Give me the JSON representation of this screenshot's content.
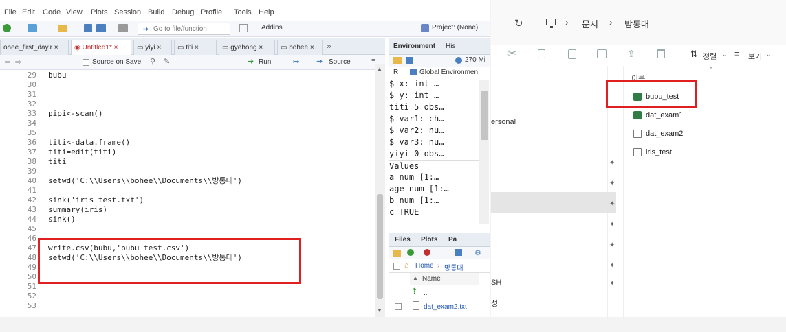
{
  "rstudio": {
    "menu": [
      "File",
      "Edit",
      "Code",
      "View",
      "Plots",
      "Session",
      "Build",
      "Debug",
      "Profile",
      "Tools",
      "Help"
    ],
    "goto_placeholder": "Go to file/function",
    "addins": "Addins",
    "project": "Project: (None)",
    "tabs": [
      "ohee_first_day.r",
      "Untitled1*",
      "yiyi",
      "titi",
      "gyehong",
      "bohee"
    ],
    "source_on_save": "Source on Save",
    "run": "Run",
    "source": "Source",
    "lines": [
      {
        "n": "29",
        "t": "bubu"
      },
      {
        "n": "30",
        "t": ""
      },
      {
        "n": "31",
        "t": ""
      },
      {
        "n": "32",
        "t": ""
      },
      {
        "n": "33",
        "t": "pipi<-scan()"
      },
      {
        "n": "34",
        "t": ""
      },
      {
        "n": "35",
        "t": ""
      },
      {
        "n": "36",
        "t": "titi<-data.frame()"
      },
      {
        "n": "37",
        "t": "titi=edit(titi)"
      },
      {
        "n": "38",
        "t": "titi"
      },
      {
        "n": "39",
        "t": ""
      },
      {
        "n": "40",
        "t": "setwd('C:\\\\Users\\\\bohee\\\\Documents\\\\방통대')"
      },
      {
        "n": "41",
        "t": ""
      },
      {
        "n": "42",
        "t": "sink('iris_test.txt')"
      },
      {
        "n": "43",
        "t": "summary(iris)"
      },
      {
        "n": "44",
        "t": "sink()"
      },
      {
        "n": "45",
        "t": ""
      },
      {
        "n": "46",
        "t": ""
      },
      {
        "n": "47",
        "t": "write.csv(bubu,'bubu_test.csv')"
      },
      {
        "n": "48",
        "t": "setwd('C:\\\\Users\\\\bohee\\\\Documents\\\\방통대')"
      },
      {
        "n": "49",
        "t": ""
      },
      {
        "n": "50",
        "t": ""
      },
      {
        "n": "51",
        "t": ""
      },
      {
        "n": "52",
        "t": ""
      },
      {
        "n": "53",
        "t": ""
      }
    ],
    "env": {
      "tab_environment": "Environment",
      "tab_history": "His",
      "mem": "270 Mi",
      "r_label": "R",
      "global_env": "Global Environmen",
      "rows": [
        "$ x: int  …",
        "$ y: int  …",
        "titi  5 obs…",
        "  $ var1: ch…",
        "  $ var2: nu…",
        "  $ var3: nu…",
        " yiyi  0 obs…",
        "Values",
        "  a    num [1:…",
        "  age  num [1:…",
        "  b    num [1:…",
        "  c    TRUE"
      ]
    },
    "files": {
      "tab_files": "Files",
      "tab_plots": "Plots",
      "tab_pa": "Pa",
      "home": "Home",
      "folder": "방통대",
      "name_col": "Name",
      "parent": "..",
      "file1": "dat_exam2.txt"
    }
  },
  "explorer": {
    "breadcrumb": [
      "문서",
      "방통대"
    ],
    "sort": "정렬",
    "view": "보기",
    "name_header": "이름",
    "files": [
      "bubu_test",
      "dat_exam1",
      "dat_exam2",
      "iris_test"
    ],
    "nav_partial": [
      "ersonal",
      "SH",
      "성"
    ]
  }
}
